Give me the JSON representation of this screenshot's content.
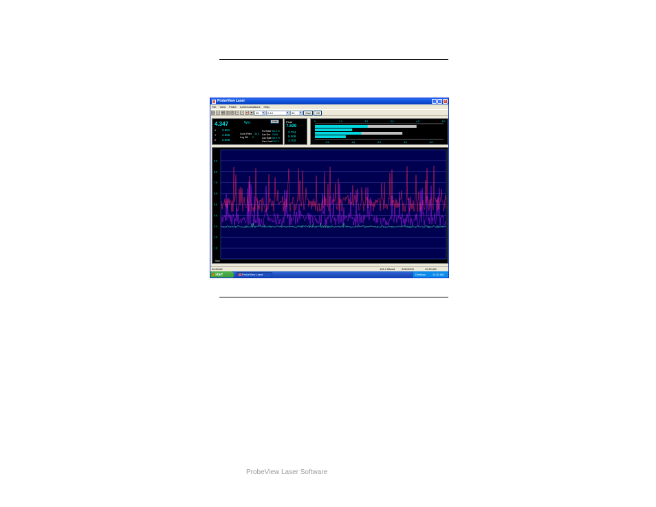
{
  "window": {
    "title": "ProbeView Laser",
    "controls": {
      "minimize": "_",
      "maximize": "□",
      "close": "x"
    }
  },
  "menu": [
    "File",
    "View",
    "Probe",
    "Communications",
    "Help"
  ],
  "toolbar": {
    "select1": "20",
    "select2": "0-10",
    "select3": "50",
    "start_label": "Start",
    "off_label": "Off"
  },
  "readout": {
    "main_value": "4.347",
    "unit": "Wm",
    "button_label": "Hold",
    "channels": [
      {
        "label": "X",
        "value": "2.561"
      },
      {
        "label": "Y",
        "value": "2.566"
      },
      {
        "label": "Z",
        "value": "2.566"
      }
    ],
    "left_params": [
      {
        "label": "Conv Filter",
        "value": "34.0"
      },
      {
        "label": "Log Off",
        "value": "0"
      }
    ],
    "right_params": [
      {
        "label": "Pct Rate",
        "value": "60.0 %"
      },
      {
        "label": "Las Dur",
        "value": "0.5%"
      },
      {
        "label": "Las Rate",
        "value": "50.0 %"
      },
      {
        "label": "Gen Vcal",
        "value": "0.07 V"
      }
    ]
  },
  "peak": {
    "title": "Peak",
    "main_value": "7.629",
    "values": [
      "2.754",
      "5.008",
      "3.700"
    ]
  },
  "bars": {
    "scale_labels": [
      "0",
      "1.0",
      "2.0",
      "3.0",
      "4.0",
      "5.0"
    ],
    "bottom_labels": [
      "0.1",
      "1.0",
      "2.0",
      "3.0",
      "4.0"
    ],
    "levels": [
      {
        "cyan": 0.41,
        "gray": 0.79
      },
      {
        "cyan": 0.29,
        "gray": 0.0
      },
      {
        "cyan": 0.36,
        "gray": 0.68
      },
      {
        "cyan": 0.24,
        "gray": 0.0
      }
    ],
    "colors": {
      "cyan": "#00d8e0",
      "gray": "#c0c0c0"
    }
  },
  "plot": {
    "y_labels": [
      "9.0",
      "8.0",
      "7.0",
      "6.0",
      "5.0",
      "4.0",
      "3.0",
      "2.0",
      "1.0"
    ],
    "x_label": "Time",
    "colors": {
      "background": "#000050",
      "grid": "#5050c0",
      "red": "#ff2a5a",
      "magenta": "#c020ff",
      "green": "#20d080"
    }
  },
  "status": {
    "left": "##:##:##",
    "baud": "115.2 kBaud",
    "date": "5/30/2005",
    "time": "11:30 AM"
  },
  "taskbar": {
    "start_label": "start",
    "app_label": "ProbeView Laser",
    "tray_label": "Desktop",
    "tray_time": "11:30 AM"
  },
  "caption": "ProbeView Laser Software"
}
